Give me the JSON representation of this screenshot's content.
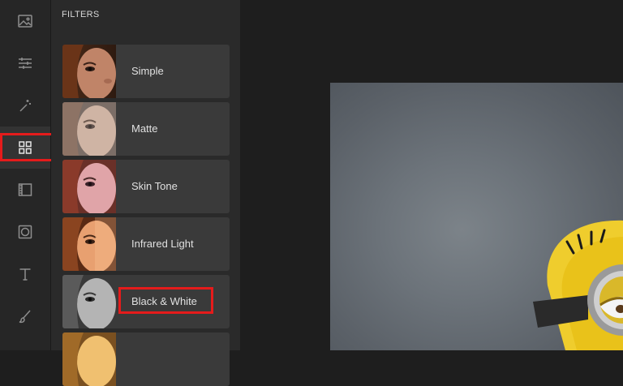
{
  "toolbar": {
    "tools": [
      {
        "name": "image-icon",
        "active": false
      },
      {
        "name": "adjustments-icon",
        "active": false
      },
      {
        "name": "magic-wand-icon",
        "active": false
      },
      {
        "name": "filters-grid-icon",
        "active": true
      },
      {
        "name": "frame-icon",
        "active": false
      },
      {
        "name": "vignette-icon",
        "active": false
      },
      {
        "name": "text-icon",
        "active": false
      },
      {
        "name": "brush-icon",
        "active": false
      }
    ]
  },
  "filters_panel": {
    "title": "FILTERS",
    "items": [
      {
        "label": "Simple",
        "tone": "color"
      },
      {
        "label": "Matte",
        "tone": "matte"
      },
      {
        "label": "Skin Tone",
        "tone": "pink"
      },
      {
        "label": "Infrared Light",
        "tone": "warm"
      },
      {
        "label": "Black & White",
        "tone": "bw"
      },
      {
        "label": "",
        "tone": "golden"
      }
    ]
  },
  "highlight_color": "#e51b1b"
}
